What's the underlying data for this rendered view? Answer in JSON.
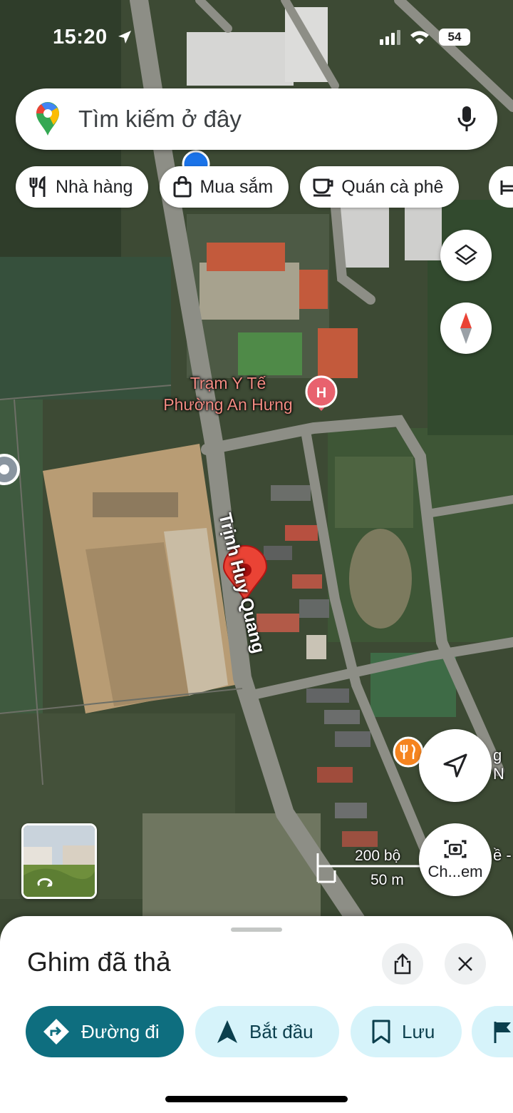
{
  "status_bar": {
    "time": "15:20",
    "battery": "54"
  },
  "search": {
    "placeholder": "Tìm kiếm ở đây"
  },
  "chips": [
    {
      "label": "Nhà hàng",
      "icon": "restaurant-icon"
    },
    {
      "label": "Mua sắm",
      "icon": "shopping-bag-icon"
    },
    {
      "label": "Quán cà phê",
      "icon": "coffee-cup-icon"
    }
  ],
  "map": {
    "poi_label_line1": "Trạm Y Tế",
    "poi_label_line2": "Phường An Hưng",
    "street_name": "Trịnh Huy Quang",
    "scale_feet": "200 bộ",
    "scale_meters": "50 m",
    "cut_label_1": "g N",
    "cut_label_2": "ề -",
    "poi_marker_letter": "H",
    "colors": {
      "pin": "#ea4335",
      "hospital": "#e8626e",
      "restaurant": "#f5841f"
    }
  },
  "buttons": {
    "camera_label": "Ch...em"
  },
  "sheet": {
    "title": "Ghim đã thả",
    "actions": [
      {
        "label": "Đường đi",
        "icon": "directions-icon"
      },
      {
        "label": "Bắt đầu",
        "icon": "navigation-arrow-icon"
      },
      {
        "label": "Lưu",
        "icon": "bookmark-icon"
      }
    ],
    "primary_color": "#0e6e7f",
    "secondary_color": "#d6f3fa"
  }
}
